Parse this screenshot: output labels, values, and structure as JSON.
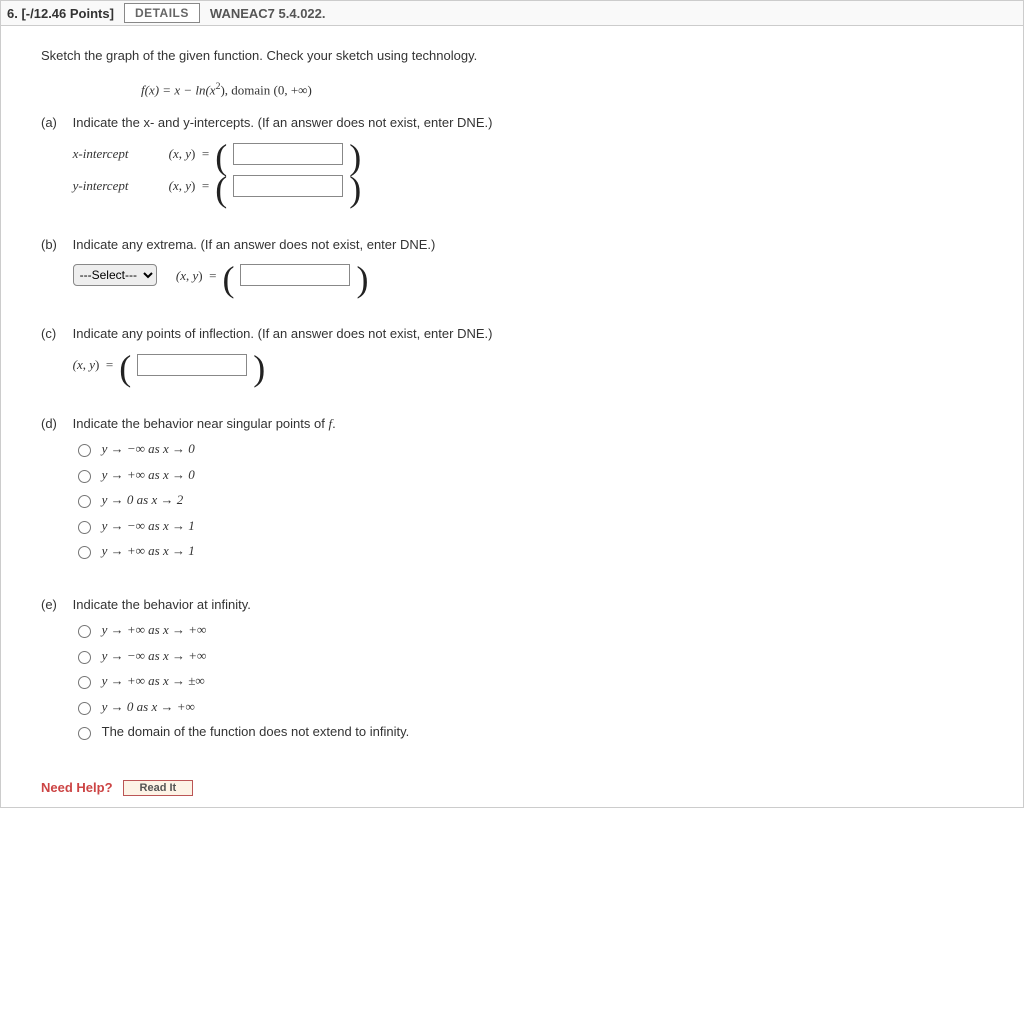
{
  "header": {
    "number": "6.",
    "points": "[-/12.46 Points]",
    "details_label": "DETAILS",
    "book_ref": "WANEAC7 5.4.022."
  },
  "instruction": "Sketch the graph of the given function. Check your sketch using technology.",
  "formula": {
    "fx": "f(x) = x − ln(x",
    "exp": "2",
    "tail": "), domain (0, +∞)"
  },
  "parts": {
    "a": {
      "label": "(a)",
      "text": "Indicate the x- and y-intercepts. (If an answer does not exist, enter DNE.)",
      "rows": [
        {
          "label": "x-intercept",
          "eq": "(x, y)  ="
        },
        {
          "label": "y-intercept",
          "eq": "(x, y)  ="
        }
      ]
    },
    "b": {
      "label": "(b)",
      "text": "Indicate any extrema. (If an answer does not exist, enter DNE.)",
      "select_placeholder": "---Select---",
      "eq": "(x, y)  ="
    },
    "c": {
      "label": "(c)",
      "text": "Indicate any points of inflection. (If an answer does not exist, enter DNE.)",
      "eq": "(x, y)  ="
    },
    "d": {
      "label": "(d)",
      "text": "Indicate the behavior near singular points of f.",
      "options": [
        "y → −∞ as x → 0",
        "y → +∞ as x → 0",
        "y → 0 as x → 2",
        "y → −∞ as x → 1",
        "y → +∞ as x → 1"
      ]
    },
    "e": {
      "label": "(e)",
      "text": "Indicate the behavior at infinity.",
      "options": [
        "y → +∞ as x → +∞",
        "y → −∞ as x → +∞",
        "y → +∞ as x → ±∞",
        "y → 0 as x → +∞",
        "The domain of the function does not extend to infinity."
      ]
    }
  },
  "need_help": {
    "label": "Need Help?",
    "readit": "Read It"
  }
}
